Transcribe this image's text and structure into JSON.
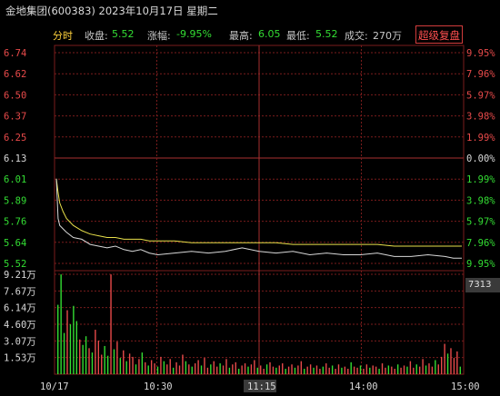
{
  "header": {
    "title": "金地集团(600383) 2023年10月17日 星期二",
    "tab": "分时",
    "close_label": "收盘:",
    "close_value": "5.52",
    "change_label": "涨幅:",
    "change_value": "-9.95%",
    "high_label": "最高:",
    "high_value": "6.05",
    "low_label": "最低:",
    "low_value": "5.52",
    "volume_label": "成交:",
    "volume_value": "270万",
    "fuquan_button": "超级复盘"
  },
  "colors": {
    "background": "#000000",
    "up": "#e84a4a",
    "down": "#33dd33",
    "price_line": "#d8d8d8",
    "avg_line": "#e8e04a",
    "grid": "#7a1c1c",
    "accent": "#ffd23c"
  },
  "price_axis": {
    "left_labels": [
      "6.74",
      "6.62",
      "6.50",
      "6.37",
      "6.25",
      "6.13",
      "6.01",
      "5.89",
      "5.76",
      "5.64",
      "5.52"
    ],
    "right_labels": [
      "9.95%",
      "7.96%",
      "5.97%",
      "3.98%",
      "1.99%",
      "0.00%",
      "1.99%",
      "3.98%",
      "5.97%",
      "7.96%",
      "9.95%"
    ]
  },
  "volume_axis": {
    "labels": [
      "9.21万",
      "7.67万",
      "6.14万",
      "4.60万",
      "3.07万",
      "1.53万"
    ],
    "edge_label": "7313"
  },
  "time_axis": {
    "labels": [
      "10/17",
      "10:30",
      "11:15",
      "14:00",
      "15:00"
    ]
  },
  "chart_data": {
    "type": "line",
    "title": "",
    "prev_close": 6.13,
    "ylim": [
      5.52,
      6.74
    ],
    "x": [
      "09:30",
      "09:31",
      "09:32",
      "09:34",
      "09:36",
      "09:40",
      "09:45",
      "09:50",
      "09:55",
      "10:00",
      "10:05",
      "10:10",
      "10:15",
      "10:20",
      "10:25",
      "10:30",
      "10:40",
      "10:50",
      "11:00",
      "11:10",
      "11:20",
      "11:30",
      "13:10",
      "13:20",
      "13:30",
      "13:40",
      "13:50",
      "14:00",
      "14:10",
      "14:20",
      "14:30",
      "14:40",
      "14:50",
      "14:55",
      "15:00"
    ],
    "series": [
      {
        "values": [
          6.01,
          5.78,
          5.74,
          5.72,
          5.7,
          5.67,
          5.66,
          5.63,
          5.62,
          5.61,
          5.62,
          5.6,
          5.59,
          5.6,
          5.58,
          5.57,
          5.58,
          5.59,
          5.58,
          5.59,
          5.61,
          5.59,
          5.58,
          5.59,
          5.57,
          5.58,
          5.57,
          5.57,
          5.58,
          5.56,
          5.56,
          5.57,
          5.56,
          5.55,
          5.55
        ]
      },
      {
        "values": [
          6.01,
          5.93,
          5.87,
          5.82,
          5.78,
          5.74,
          5.71,
          5.69,
          5.68,
          5.67,
          5.67,
          5.66,
          5.66,
          5.66,
          5.65,
          5.65,
          5.65,
          5.64,
          5.64,
          5.64,
          5.64,
          5.64,
          5.64,
          5.63,
          5.63,
          5.63,
          5.63,
          5.63,
          5.63,
          5.62,
          5.62,
          5.62,
          5.62,
          5.62,
          5.62
        ]
      }
    ],
    "volume": {
      "ylim": [
        0,
        9.21
      ],
      "unit": "万",
      "bars": [
        [
          6.4,
          "d"
        ],
        [
          9.2,
          "d"
        ],
        [
          3.8,
          "d"
        ],
        [
          5.9,
          "u"
        ],
        [
          4.6,
          "d"
        ],
        [
          6.3,
          "d"
        ],
        [
          4.9,
          "d"
        ],
        [
          3.2,
          "u"
        ],
        [
          2.7,
          "d"
        ],
        [
          3.5,
          "d"
        ],
        [
          2.4,
          "u"
        ],
        [
          2.0,
          "d"
        ],
        [
          4.1,
          "u"
        ],
        [
          3.1,
          "u"
        ],
        [
          1.8,
          "u"
        ],
        [
          2.6,
          "d"
        ],
        [
          1.7,
          "d"
        ],
        [
          9.2,
          "u"
        ],
        [
          2.3,
          "d"
        ],
        [
          3.0,
          "u"
        ],
        [
          1.5,
          "d"
        ],
        [
          2.2,
          "u"
        ],
        [
          1.2,
          "d"
        ],
        [
          1.9,
          "u"
        ],
        [
          1.6,
          "u"
        ],
        [
          0.9,
          "d"
        ],
        [
          1.4,
          "u"
        ],
        [
          2.0,
          "d"
        ],
        [
          1.1,
          "u"
        ],
        [
          0.8,
          "d"
        ],
        [
          1.3,
          "u"
        ],
        [
          1.0,
          "u"
        ],
        [
          0.7,
          "d"
        ],
        [
          1.6,
          "u"
        ],
        [
          1.2,
          "d"
        ],
        [
          0.9,
          "u"
        ],
        [
          1.4,
          "u"
        ],
        [
          0.6,
          "d"
        ],
        [
          1.1,
          "u"
        ],
        [
          0.8,
          "u"
        ],
        [
          1.8,
          "u"
        ],
        [
          1.2,
          "d"
        ],
        [
          0.9,
          "u"
        ],
        [
          0.7,
          "d"
        ],
        [
          1.0,
          "u"
        ],
        [
          1.3,
          "u"
        ],
        [
          0.8,
          "d"
        ],
        [
          1.5,
          "u"
        ],
        [
          0.6,
          "u"
        ],
        [
          0.9,
          "d"
        ],
        [
          1.2,
          "u"
        ],
        [
          0.7,
          "u"
        ],
        [
          1.0,
          "d"
        ],
        [
          0.8,
          "u"
        ],
        [
          1.4,
          "u"
        ],
        [
          0.6,
          "d"
        ],
        [
          0.9,
          "u"
        ],
        [
          1.1,
          "u"
        ],
        [
          0.5,
          "d"
        ],
        [
          0.8,
          "u"
        ],
        [
          1.0,
          "u"
        ],
        [
          0.7,
          "d"
        ],
        [
          0.9,
          "u"
        ],
        [
          1.3,
          "u"
        ],
        [
          0.6,
          "d"
        ],
        [
          0.8,
          "u"
        ],
        [
          0.5,
          "u"
        ],
        [
          0.9,
          "d"
        ],
        [
          1.1,
          "u"
        ],
        [
          0.7,
          "u"
        ],
        [
          0.6,
          "d"
        ],
        [
          0.8,
          "u"
        ],
        [
          1.0,
          "u"
        ],
        [
          0.5,
          "d"
        ],
        [
          0.7,
          "u"
        ],
        [
          0.9,
          "u"
        ],
        [
          0.6,
          "d"
        ],
        [
          0.8,
          "u"
        ],
        [
          1.2,
          "u"
        ],
        [
          0.5,
          "d"
        ],
        [
          0.7,
          "u"
        ],
        [
          0.9,
          "u"
        ],
        [
          0.6,
          "d"
        ],
        [
          0.8,
          "u"
        ],
        [
          0.5,
          "u"
        ],
        [
          0.7,
          "d"
        ],
        [
          1.0,
          "u"
        ],
        [
          0.6,
          "u"
        ],
        [
          0.8,
          "d"
        ],
        [
          0.5,
          "u"
        ],
        [
          0.9,
          "u"
        ],
        [
          0.6,
          "d"
        ],
        [
          0.7,
          "u"
        ],
        [
          0.5,
          "u"
        ],
        [
          1.1,
          "d"
        ],
        [
          0.7,
          "u"
        ],
        [
          0.6,
          "u"
        ],
        [
          0.8,
          "d"
        ],
        [
          0.5,
          "u"
        ],
        [
          0.9,
          "u"
        ],
        [
          0.6,
          "d"
        ],
        [
          0.8,
          "u"
        ],
        [
          0.7,
          "u"
        ],
        [
          0.5,
          "d"
        ],
        [
          1.0,
          "u"
        ],
        [
          0.6,
          "u"
        ],
        [
          0.8,
          "d"
        ],
        [
          0.7,
          "u"
        ],
        [
          0.5,
          "u"
        ],
        [
          0.9,
          "d"
        ],
        [
          0.6,
          "u"
        ],
        [
          0.8,
          "u"
        ],
        [
          0.7,
          "d"
        ],
        [
          1.2,
          "u"
        ],
        [
          0.6,
          "u"
        ],
        [
          0.9,
          "d"
        ],
        [
          0.7,
          "u"
        ],
        [
          1.4,
          "u"
        ],
        [
          0.8,
          "d"
        ],
        [
          1.0,
          "u"
        ],
        [
          0.7,
          "u"
        ],
        [
          1.3,
          "d"
        ],
        [
          0.9,
          "u"
        ],
        [
          1.6,
          "u"
        ],
        [
          2.8,
          "u"
        ],
        [
          1.9,
          "d"
        ],
        [
          2.4,
          "u"
        ],
        [
          1.5,
          "u"
        ],
        [
          2.1,
          "u"
        ],
        [
          0.7,
          "d"
        ]
      ]
    }
  }
}
